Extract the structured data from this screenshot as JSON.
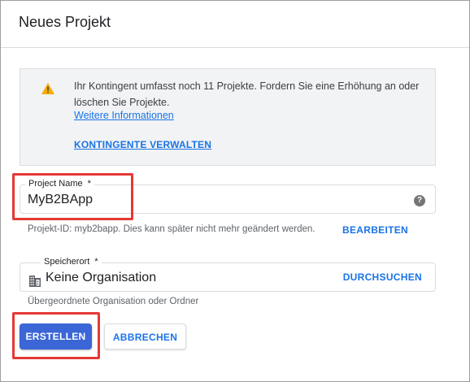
{
  "dialog": {
    "title": "Neues Projekt"
  },
  "notice": {
    "icon": "warning-icon",
    "text": "Ihr Kontingent umfasst noch 11 Projekte. Fordern Sie eine Erhöhung an oder löschen Sie Projekte.",
    "more_info_link": "Weitere Informationen",
    "manage_quota_link": "KONTINGENTE VERWALTEN"
  },
  "project_name": {
    "label": "Project Name",
    "required_marker": "*",
    "value": "MyB2BApp",
    "help_icon": "help-icon",
    "help_glyph": "?"
  },
  "project_id": {
    "hint": "Projekt-ID: myb2bapp. Dies kann später nicht mehr geändert werden.",
    "edit_label": "BEARBEITEN"
  },
  "location": {
    "label": "Speicherort",
    "required_marker": "*",
    "value": "Keine Organisation",
    "icon": "building-icon",
    "browse_label": "DURCHSUCHEN",
    "hint": "Übergeordnete Organisation oder Ordner"
  },
  "actions": {
    "create_label": "ERSTELLEN",
    "cancel_label": "ABBRECHEN"
  },
  "colors": {
    "primary": "#3b66d6",
    "link": "#1a73e8",
    "warning": "#f9ab00",
    "highlight": "#e53935",
    "notice_bg": "#f1f3f4"
  }
}
